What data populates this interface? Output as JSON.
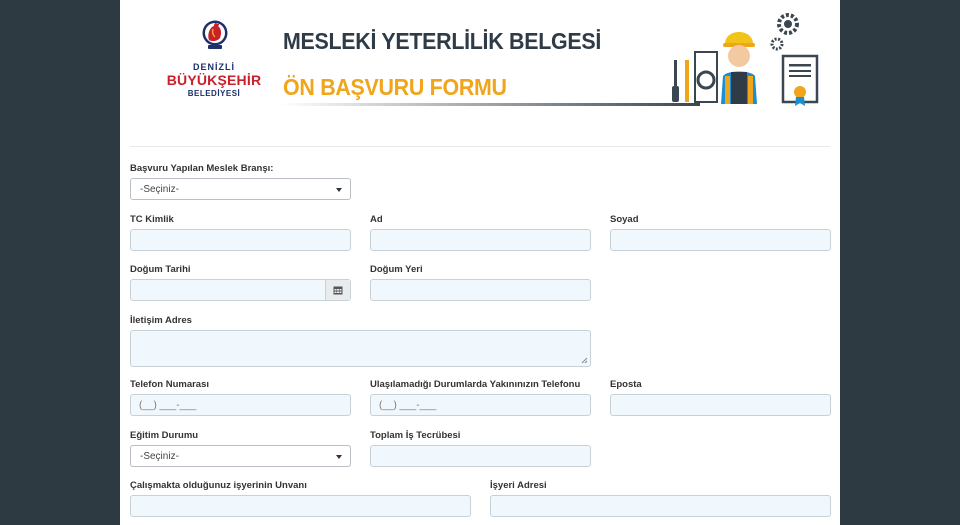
{
  "header": {
    "logo": {
      "line1": "DENİZLİ",
      "line2": "BÜYÜKŞEHİR",
      "line3": "BELEDİYESİ"
    },
    "title_line1": "MESLEKİ YETERLİLİK BELGESİ",
    "title_line2": "ÖN BAŞVURU FORMU",
    "colors": {
      "title_dark": "#2f3b46",
      "title_accent": "#f0a51a",
      "logo_red": "#c8202c",
      "logo_navy": "#1e2f6b"
    }
  },
  "form": {
    "branch": {
      "label": "Başvuru Yapılan Meslek Branşı:",
      "value": "-Seçiniz-"
    },
    "tc": {
      "label": "TC Kimlik",
      "value": ""
    },
    "ad": {
      "label": "Ad",
      "value": ""
    },
    "soyad": {
      "label": "Soyad",
      "value": ""
    },
    "dogum_tarihi": {
      "label": "Doğum Tarihi",
      "value": "",
      "icon": "calendar-icon"
    },
    "dogum_yeri": {
      "label": "Doğum Yeri",
      "value": ""
    },
    "adres": {
      "label": "İletişim Adres",
      "value": ""
    },
    "telefon": {
      "label": "Telefon Numarası",
      "placeholder": "(__) ___-___"
    },
    "yakin_telefon": {
      "label": "Ulaşılamadığı Durumlarda Yakınınızın Telefonu",
      "placeholder": "(__) ___-___"
    },
    "eposta": {
      "label": "Eposta",
      "value": ""
    },
    "egitim": {
      "label": "Eğitim Durumu",
      "value": "-Seçiniz-"
    },
    "tecrube": {
      "label": "Toplam İş Tecrübesi",
      "value": ""
    },
    "isyeri_unvan": {
      "label": "Çalışmakta olduğunuz işyerinin Unvanı",
      "value": ""
    },
    "isyeri_adres": {
      "label": "İşyeri Adresi",
      "value": ""
    }
  }
}
